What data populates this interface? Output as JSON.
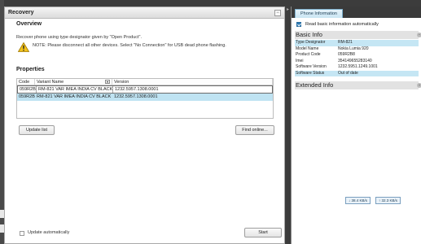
{
  "recovery": {
    "title": "Recovery",
    "collapse_glyph": "−",
    "overview": {
      "heading": "Overview",
      "description": "Recover phone using type designator given by \"Open Product\".",
      "note": "NOTE: Please disconnect all other devices. Select \"No Connection\" for USB dead phone flashing."
    },
    "properties": {
      "heading": "Properties",
      "columns": [
        "Code",
        "Variant Name",
        "Version"
      ],
      "rows": [
        {
          "code": "059R2B8",
          "variant": "RM-821 VAR IMEA INDIA CV BLACK",
          "version": "1232.5957.1308.0001"
        },
        {
          "code": "059R2B8",
          "variant": "RM-821 VAR IMEA INDIA CV BLACK",
          "version": "1232.5957.1308.0001"
        }
      ]
    },
    "buttons": {
      "update_list": "Update list",
      "find_online": "Find online...",
      "start": "Start"
    },
    "update_automatically": "Update automatically"
  },
  "phone_info": {
    "tab": "Phone Information",
    "read_auto": "Read basic information automatically",
    "basic_info": "Basic Info",
    "extended_info": "Extended Info",
    "rows": [
      {
        "key": "Type Designator",
        "value": "RM-821"
      },
      {
        "key": "Model Name",
        "value": "Nokia Lumia 920"
      },
      {
        "key": "Product Code",
        "value": "059R2B8"
      },
      {
        "key": "Imei",
        "value": "354149655283140"
      },
      {
        "key": "Software Version",
        "value": "1232.5951.1249.1001"
      },
      {
        "key": "Software Status",
        "value": "Out of date"
      }
    ],
    "highlight_rows": [
      0,
      5
    ]
  },
  "status": {
    "download_speed": "↓ 38.4 KB/s",
    "upload_speed": "↑ 32.3 KB/s"
  },
  "colors": {
    "selected_row": "#bfe3f2",
    "accent": "#2c7bb6"
  }
}
